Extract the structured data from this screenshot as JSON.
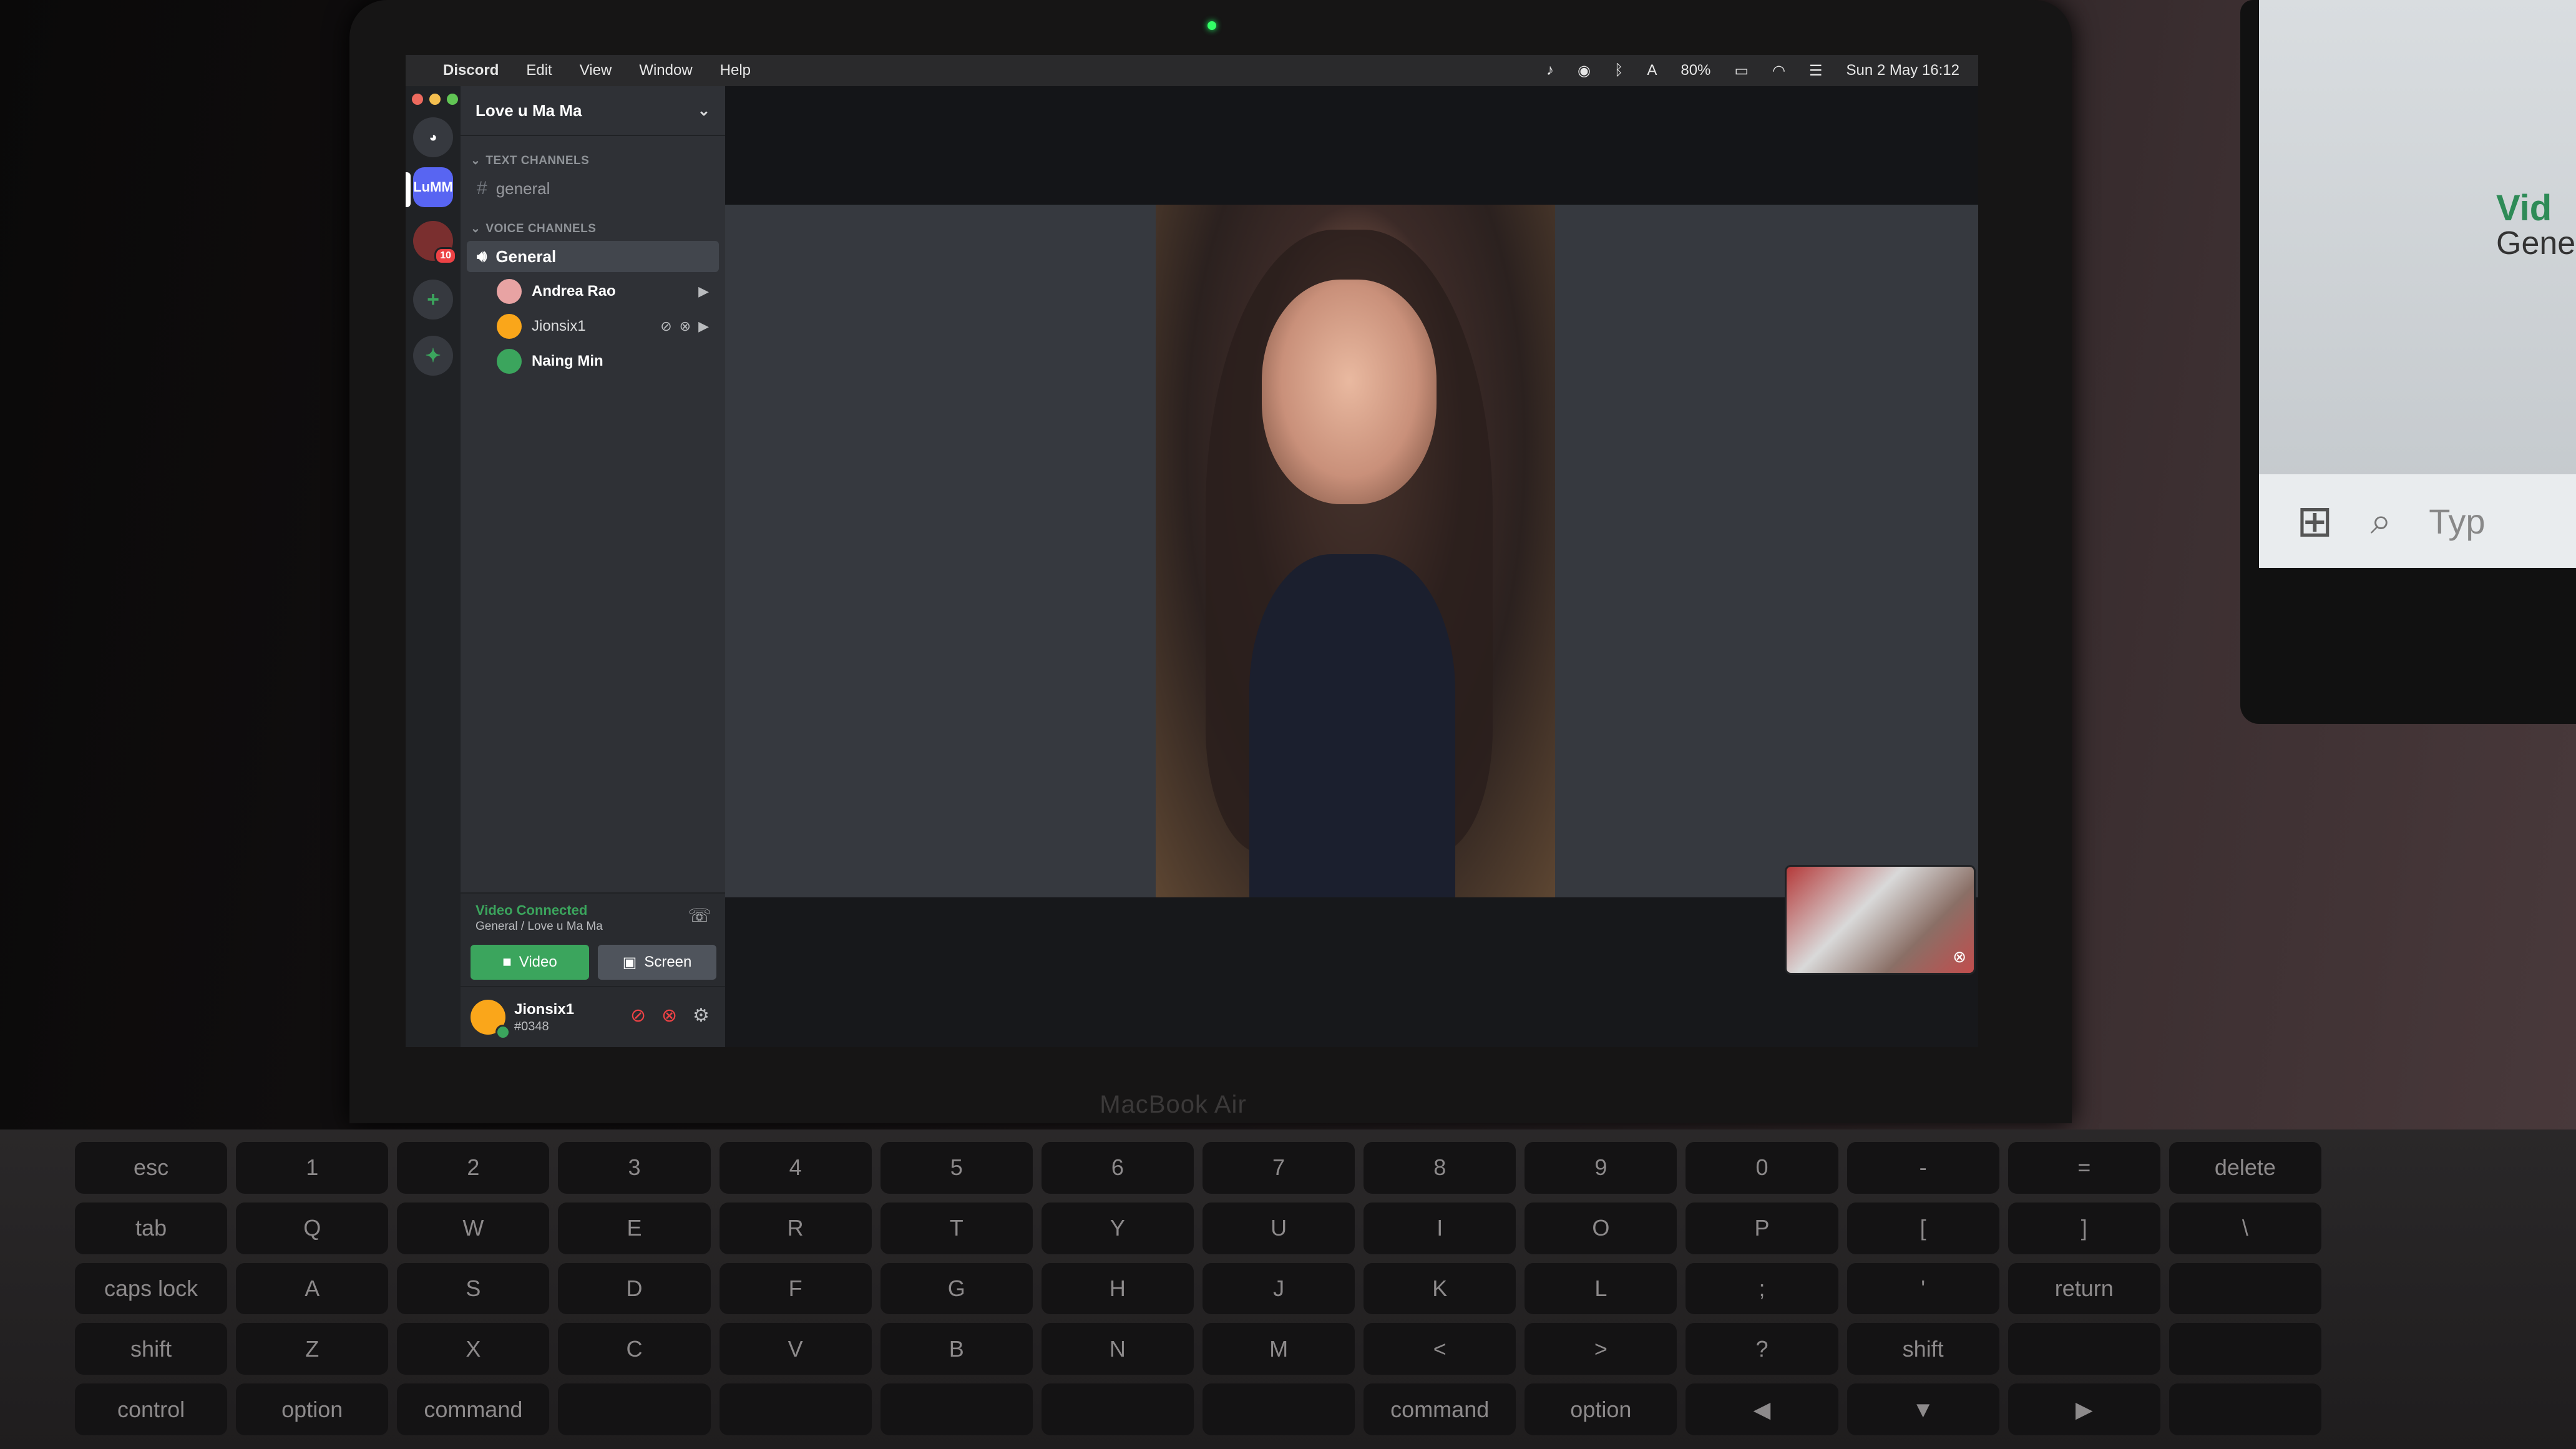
{
  "menubar": {
    "items": [
      "Discord",
      "Edit",
      "View",
      "Window",
      "Help"
    ],
    "battery": "80%",
    "clock": "Sun 2 May  16:12"
  },
  "guilds": {
    "lumm_label": "LuMM",
    "badge_count": "10"
  },
  "server": {
    "name": "Love u Ma Ma"
  },
  "channels": {
    "text_category": "TEXT CHANNELS",
    "text": [
      {
        "name": "general"
      }
    ],
    "voice_category": "VOICE CHANNELS",
    "voice": [
      {
        "name": "General"
      }
    ],
    "voice_users": [
      {
        "name": "Andrea Rao",
        "color": "#e8a3a3"
      },
      {
        "name": "Jionsix1",
        "color": "#faa61a"
      },
      {
        "name": "Naing Min",
        "color": "#3ba55d"
      }
    ]
  },
  "voice_panel": {
    "status": "Video Connected",
    "location": "General / Love u Ma Ma",
    "video_label": "Video",
    "screen_label": "Screen"
  },
  "user_panel": {
    "username": "Jionsix1",
    "tag": "#0348"
  },
  "hardware": {
    "brand": "MacBook Air",
    "keys": [
      "esc",
      "1",
      "2",
      "3",
      "4",
      "5",
      "6",
      "7",
      "8",
      "9",
      "0",
      "-",
      "=",
      "delete",
      "tab",
      "Q",
      "W",
      "E",
      "R",
      "T",
      "Y",
      "U",
      "I",
      "O",
      "P",
      "[",
      "]",
      "\\",
      "caps lock",
      "A",
      "S",
      "D",
      "F",
      "G",
      "H",
      "J",
      "K",
      "L",
      ";",
      "'",
      "return",
      "",
      "shift",
      "Z",
      "X",
      "C",
      "V",
      "B",
      "N",
      "M",
      "<",
      ">",
      "?",
      "shift",
      "",
      "",
      "control",
      "option",
      "command",
      "",
      "",
      "",
      "",
      "",
      "command",
      "option",
      "◀",
      "▼",
      "▶",
      ""
    ]
  },
  "second_monitor": {
    "video_text": "Vid",
    "general_text": "General",
    "search_text": "Typ"
  },
  "colors": {
    "accent_green": "#3ba55d",
    "sidebar": "#2f3136",
    "rail": "#202225",
    "stage": "#36393f"
  }
}
